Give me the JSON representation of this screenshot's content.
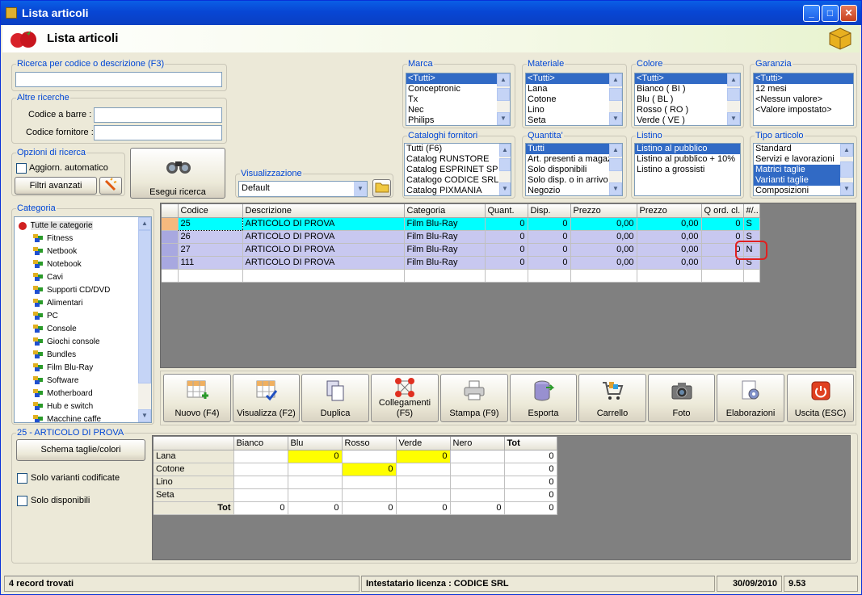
{
  "window": {
    "title": "Lista articoli",
    "header": "Lista articoli"
  },
  "search": {
    "code_group": "Ricerca per codice o descrizione (F3)",
    "code_value": "",
    "other_group": "Altre ricerche",
    "barcode_label": "Codice a barre :",
    "supplier_code_label": "Codice fornitore :",
    "options_group": "Opzioni di ricerca",
    "auto_update_label": "Aggiorn. automatico",
    "advanced_filters": "Filtri avanzati",
    "run_search": "Esegui ricerca",
    "view_group": "Visualizzazione",
    "view_value": "Default"
  },
  "filters": {
    "marca": {
      "label": "Marca",
      "items": [
        "<Tutti>",
        "Conceptronic",
        "Tx",
        "Nec",
        "Philips"
      ]
    },
    "materiale": {
      "label": "Materiale",
      "items": [
        "<Tutti>",
        "Lana",
        "Cotone",
        "Lino",
        "Seta"
      ]
    },
    "colore": {
      "label": "Colore",
      "items": [
        "<Tutti>",
        "Bianco ( BI )",
        "Blu ( BL )",
        "Rosso ( RO )",
        "Verde ( VE )"
      ]
    },
    "garanzia": {
      "label": "Garanzia",
      "items": [
        "<Tutti>",
        "12 mesi",
        "<Nessun valore>",
        "<Valore impostato>"
      ]
    },
    "cataloghi": {
      "label": "Cataloghi fornitori",
      "items": [
        "Tutti (F6)",
        "Catalog RUNSTORE",
        "Catalog ESPRINET SP",
        "Catalogo CODICE SRL",
        "Catalog PIXMANIA"
      ]
    },
    "quantita": {
      "label": "Quantita'",
      "items": [
        "Tutti",
        "Art. presenti a magaz",
        "Solo disponibili",
        "Solo disp. o in arrivo",
        "Negozio"
      ]
    },
    "listino": {
      "label": "Listino",
      "items": [
        "Listino al pubblico",
        "Listino al pubblico + 10%",
        "Listino a grossisti"
      ]
    },
    "tipo": {
      "label": "Tipo articolo",
      "items": [
        "Standard",
        "Servizi e lavorazioni",
        "Matrici taglie",
        "Varianti taglie",
        "Composizioni"
      ]
    }
  },
  "categories": {
    "label": "Categoria",
    "root": "Tutte le categorie",
    "items": [
      "Fitness",
      "Netbook",
      "Notebook",
      "Cavi",
      "Supporti CD/DVD",
      "Alimentari",
      "PC",
      "Console",
      "Giochi console",
      "Bundles",
      "Film Blu-Ray",
      "Software",
      "Motherboard",
      "Hub e switch",
      "Macchine caffe"
    ]
  },
  "articles": {
    "columns": [
      "Codice",
      "Descrizione",
      "Categoria",
      "Quant.",
      "Disp.",
      "Prezzo",
      "Prezzo",
      "Q ord. cl.",
      "#/.."
    ],
    "rows": [
      [
        "25",
        "ARTICOLO DI PROVA",
        "Film Blu-Ray",
        "0",
        "0",
        "0,00",
        "0,00",
        "0",
        "S"
      ],
      [
        "26",
        "ARTICOLO DI PROVA",
        "Film Blu-Ray",
        "0",
        "0",
        "0,00",
        "0,00",
        "0",
        "S"
      ],
      [
        "27",
        "ARTICOLO DI PROVA",
        "Film Blu-Ray",
        "0",
        "0",
        "0,00",
        "0,00",
        "0",
        "N"
      ],
      [
        "111",
        "ARTICOLO DI PROVA",
        "Film Blu-Ray",
        "0",
        "0",
        "0,00",
        "0,00",
        "0",
        "S"
      ]
    ]
  },
  "toolbar": {
    "nuovo": "Nuovo (F4)",
    "visualizza": "Visualizza (F2)",
    "duplica": "Duplica",
    "collegamenti": "Collegamenti",
    "collegamenti_key": "(F5)",
    "stampa": "Stampa (F9)",
    "esporta": "Esporta",
    "carrello": "Carrello",
    "foto": "Foto",
    "elaborazioni": "Elaborazioni",
    "uscita": "Uscita (ESC)"
  },
  "detail": {
    "group": "25 - ARTICOLO DI PROVA",
    "scheme_button": "Schema taglie/colori",
    "only_coded_label": "Solo varianti codificate",
    "only_available_label": "Solo disponibili",
    "matrix": {
      "columns": [
        "Bianco",
        "Blu",
        "Rosso",
        "Verde",
        "Nero",
        "Tot"
      ],
      "rows": [
        {
          "name": "Lana",
          "cells": [
            "",
            "0",
            "",
            "0",
            "",
            "0"
          ]
        },
        {
          "name": "Cotone",
          "cells": [
            "",
            "",
            "0",
            "",
            "",
            "0"
          ]
        },
        {
          "name": "Lino",
          "cells": [
            "",
            "",
            "",
            "",
            "",
            "0"
          ]
        },
        {
          "name": "Seta",
          "cells": [
            "",
            "",
            "",
            "",
            "",
            "0"
          ]
        }
      ],
      "total_label": "Tot",
      "totals": [
        "0",
        "0",
        "0",
        "0",
        "0",
        "0"
      ]
    }
  },
  "status": {
    "records": "4 record trovati",
    "license": "Intestatario licenza : CODICE SRL",
    "date": "30/09/2010",
    "time": "9.53"
  },
  "colors": {
    "row_selected": "#00ffff",
    "row_normal": "#c8c8f0",
    "matrix_highlight": "#ffff00",
    "annotation": "#e02020"
  }
}
